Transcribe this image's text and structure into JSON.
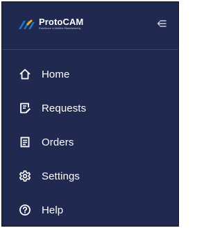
{
  "sidebar": {
    "brand": {
      "name": "ProtoCAM",
      "tagline": "Excellence in Additive Manufacturing",
      "colors": {
        "mark_primary": "#1e78c8",
        "mark_accent": "#f5a623"
      }
    },
    "collapse_icon": "collapse-menu-icon",
    "items": [
      {
        "label": "Home",
        "icon": "home-icon"
      },
      {
        "label": "Requests",
        "icon": "requests-icon"
      },
      {
        "label": "Orders",
        "icon": "orders-icon"
      },
      {
        "label": "Settings",
        "icon": "settings-gear-icon"
      },
      {
        "label": "Help",
        "icon": "help-icon"
      }
    ]
  },
  "colors": {
    "background": "#20294f",
    "text": "#ffffff",
    "divider": "#3a4470"
  }
}
